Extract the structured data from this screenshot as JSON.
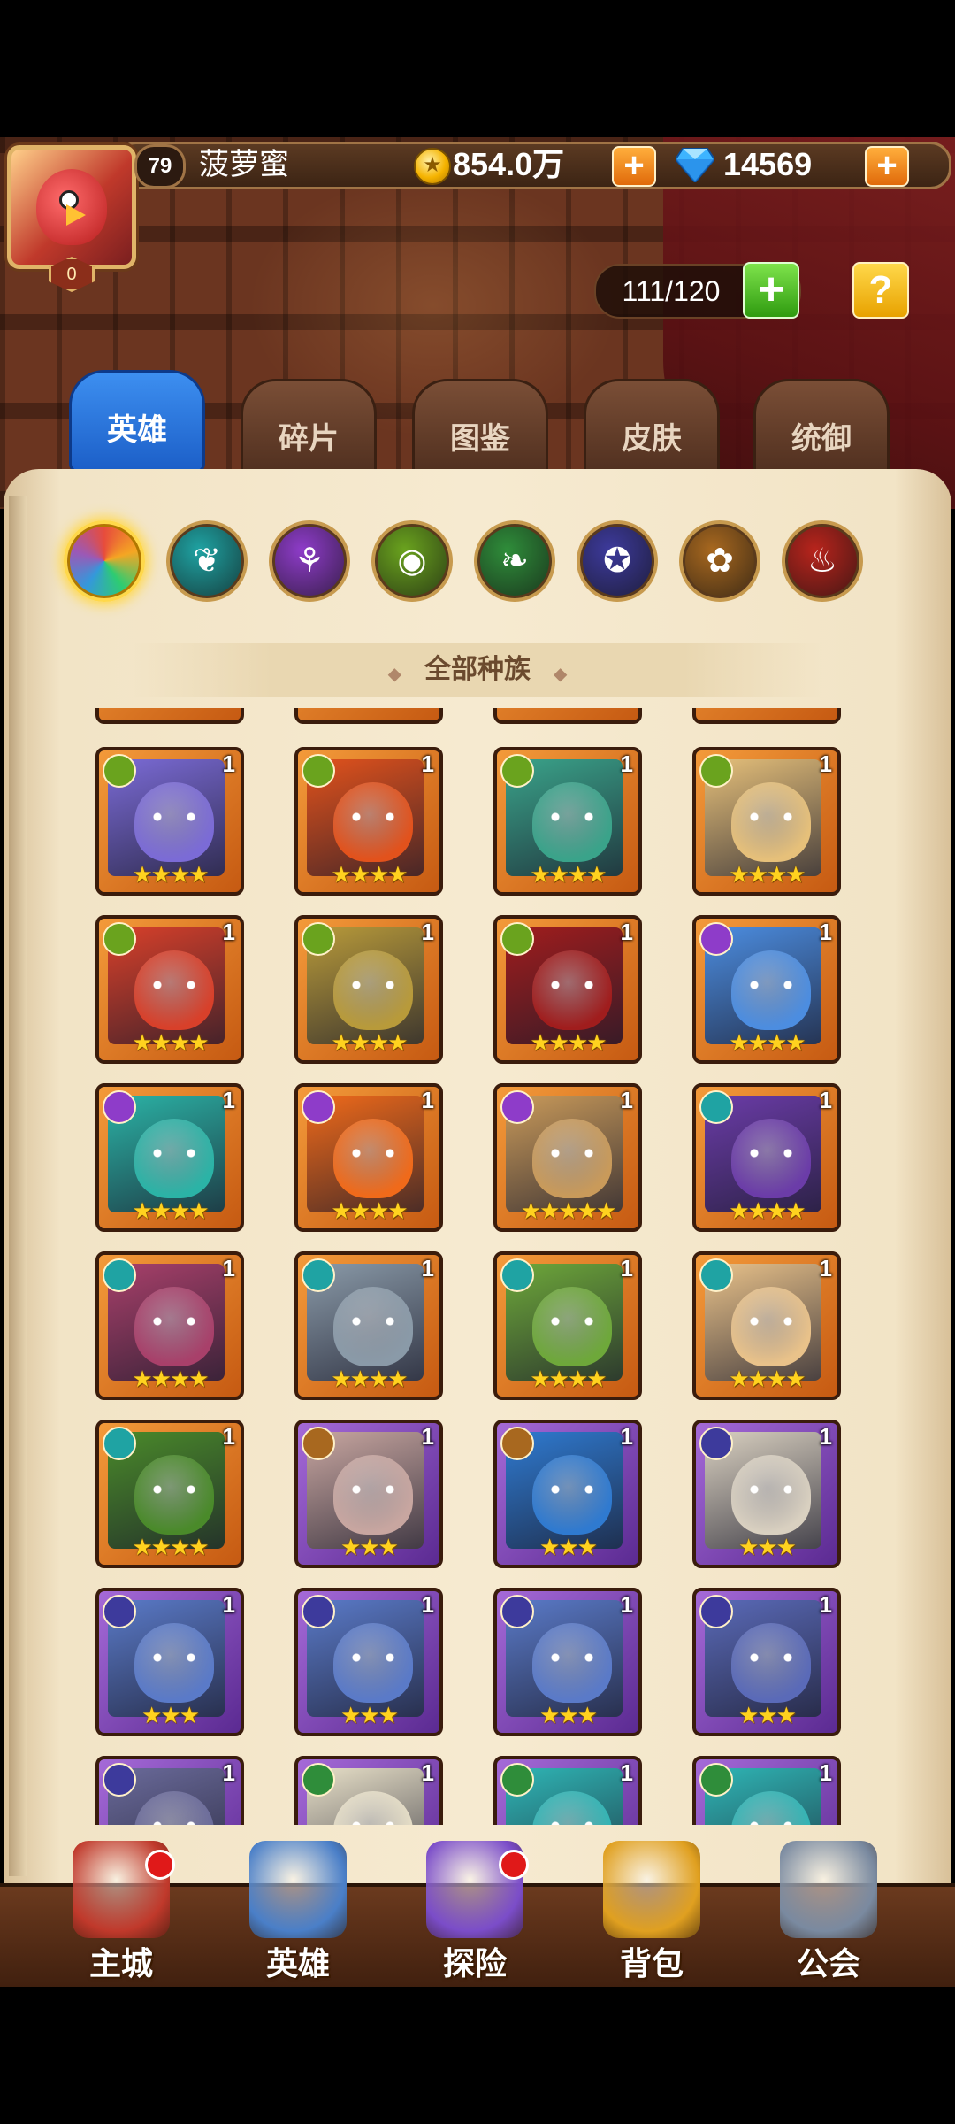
{
  "player": {
    "level": "79",
    "name": "菠萝蜜",
    "vip": "0",
    "gold": "854.0万",
    "gems": "14569",
    "capacity": "111/120"
  },
  "tabs": [
    {
      "label": "英雄",
      "active": true
    },
    {
      "label": "碎片",
      "active": false
    },
    {
      "label": "图鉴",
      "active": false
    },
    {
      "label": "皮肤",
      "active": false
    },
    {
      "label": "统御",
      "active": false
    }
  ],
  "races": [
    {
      "icon": "all-races-icon",
      "color": "#e74c3c",
      "selected": true
    },
    {
      "icon": "forest-race-icon",
      "color": "#1fa3a3",
      "selected": false
    },
    {
      "icon": "shadow-race-icon",
      "color": "#8e3cc9",
      "selected": false
    },
    {
      "icon": "eye-race-icon",
      "color": "#6aa31e",
      "selected": false
    },
    {
      "icon": "leaf-race-icon",
      "color": "#2f8d3a",
      "selected": false
    },
    {
      "icon": "demon-race-icon",
      "color": "#3d3a9c",
      "selected": false
    },
    {
      "icon": "sun-race-icon",
      "color": "#a8681f",
      "selected": false
    },
    {
      "icon": "dark-race-icon",
      "color": "#b8241c",
      "selected": false
    }
  ],
  "filter_label": "全部种族",
  "heroes": [
    {
      "level": "1",
      "stars": "★★★★",
      "frame": "o",
      "race": "#6aa31e",
      "tint": "#7b6bd6"
    },
    {
      "level": "1",
      "stars": "★★★★",
      "frame": "o",
      "race": "#6aa31e",
      "tint": "#e2521c"
    },
    {
      "level": "1",
      "stars": "★★★★",
      "frame": "o",
      "race": "#6aa31e",
      "tint": "#3aa38a"
    },
    {
      "level": "1",
      "stars": "★★★★",
      "frame": "o",
      "race": "#6aa31e",
      "tint": "#e6c07a"
    },
    {
      "level": "1",
      "stars": "★★★★",
      "frame": "o",
      "race": "#6aa31e",
      "tint": "#d8402a"
    },
    {
      "level": "1",
      "stars": "★★★★",
      "frame": "o",
      "race": "#6aa31e",
      "tint": "#b89a3a"
    },
    {
      "level": "1",
      "stars": "★★★★",
      "frame": "o",
      "race": "#6aa31e",
      "tint": "#a01d1d"
    },
    {
      "level": "1",
      "stars": "★★★★",
      "frame": "o",
      "race": "#8e3cc9",
      "tint": "#4c8de0"
    },
    {
      "level": "1",
      "stars": "★★★★",
      "frame": "o",
      "race": "#8e3cc9",
      "tint": "#2bb3a6"
    },
    {
      "level": "1",
      "stars": "★★★★",
      "frame": "o",
      "race": "#8e3cc9",
      "tint": "#f06a1a"
    },
    {
      "level": "1",
      "stars": "★★★★★",
      "frame": "o",
      "race": "#8e3cc9",
      "tint": "#c99a5a"
    },
    {
      "level": "1",
      "stars": "★★★★",
      "frame": "o",
      "race": "#1fa3a3",
      "tint": "#6b3ca8"
    },
    {
      "level": "1",
      "stars": "★★★★",
      "frame": "o",
      "race": "#1fa3a3",
      "tint": "#a8406a"
    },
    {
      "level": "1",
      "stars": "★★★★",
      "frame": "o",
      "race": "#1fa3a3",
      "tint": "#8a9aa8"
    },
    {
      "level": "1",
      "stars": "★★★★",
      "frame": "o",
      "race": "#1fa3a3",
      "tint": "#6ea83a"
    },
    {
      "level": "1",
      "stars": "★★★★",
      "frame": "o",
      "race": "#1fa3a3",
      "tint": "#e9c28a"
    },
    {
      "level": "1",
      "stars": "★★★★",
      "frame": "o",
      "race": "#1fa3a3",
      "tint": "#4a8a2a"
    },
    {
      "level": "1",
      "stars": "★★★",
      "frame": "p",
      "race": "#a8681f",
      "tint": "#c8a6a0"
    },
    {
      "level": "1",
      "stars": "★★★",
      "frame": "p",
      "race": "#a8681f",
      "tint": "#2f7ad0"
    },
    {
      "level": "1",
      "stars": "★★★",
      "frame": "p",
      "race": "#3d3a9c",
      "tint": "#d9d0c0"
    },
    {
      "level": "1",
      "stars": "★★★",
      "frame": "p",
      "race": "#3d3a9c",
      "tint": "#5a7ac8"
    },
    {
      "level": "1",
      "stars": "★★★",
      "frame": "p",
      "race": "#3d3a9c",
      "tint": "#5a7ac8"
    },
    {
      "level": "1",
      "stars": "★★★",
      "frame": "p",
      "race": "#3d3a9c",
      "tint": "#5a7ac8"
    },
    {
      "level": "1",
      "stars": "★★★",
      "frame": "p",
      "race": "#3d3a9c",
      "tint": "#5a6ab8"
    },
    {
      "level": "1",
      "stars": "★★★",
      "frame": "p",
      "race": "#3d3a9c",
      "tint": "#6a6a9a"
    },
    {
      "level": "1",
      "stars": "★★★",
      "frame": "p",
      "race": "#2f8d3a",
      "tint": "#e8e0c8"
    },
    {
      "level": "1",
      "stars": "★★★",
      "frame": "p",
      "race": "#2f8d3a",
      "tint": "#2fb5b5"
    },
    {
      "level": "1",
      "stars": "★★★",
      "frame": "p",
      "race": "#2f8d3a",
      "tint": "#2fb5b5"
    }
  ],
  "nav": [
    {
      "label": "主城",
      "icon": "castle-icon",
      "badge": true
    },
    {
      "label": "英雄",
      "icon": "hero-icon",
      "badge": false
    },
    {
      "label": "探险",
      "icon": "portal-icon",
      "badge": true
    },
    {
      "label": "背包",
      "icon": "backpack-icon",
      "badge": false
    },
    {
      "label": "公会",
      "icon": "guild-icon",
      "badge": false
    }
  ]
}
